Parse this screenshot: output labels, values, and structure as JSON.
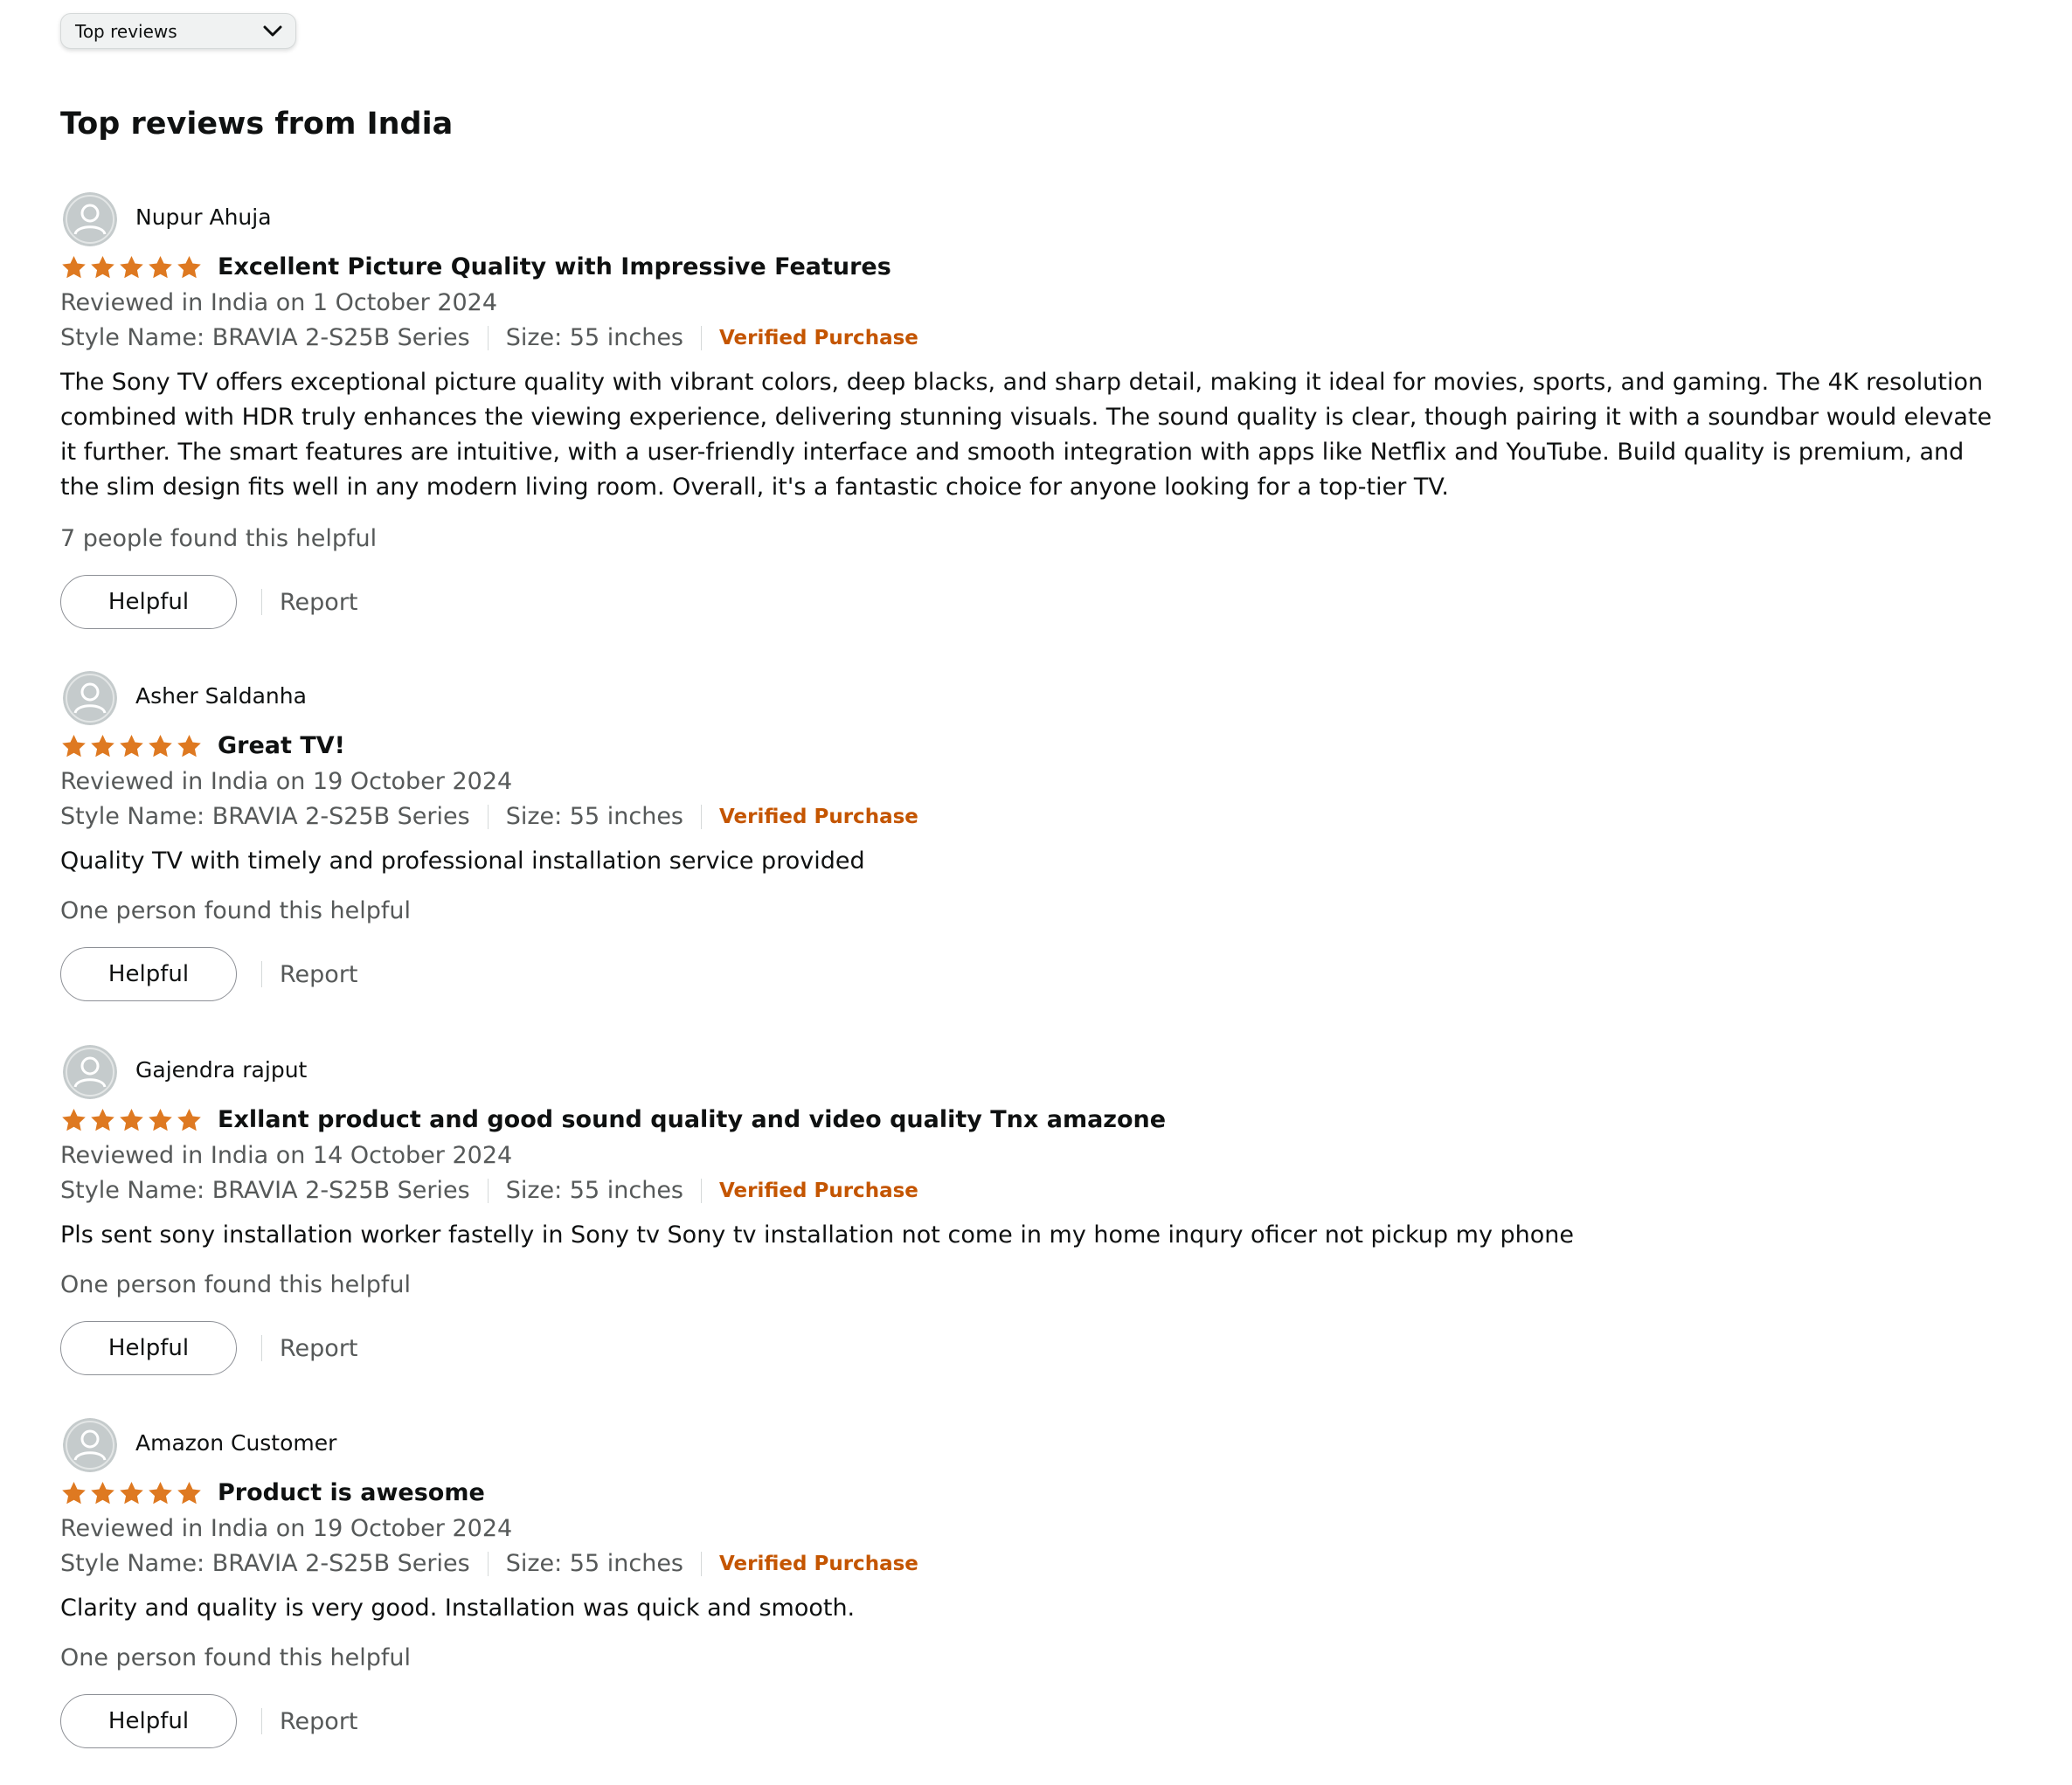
{
  "sort": {
    "selected": "Top reviews"
  },
  "heading": "Top reviews from India",
  "colors": {
    "star": "#de7921",
    "verified": "#c45500",
    "muted": "#565959",
    "text": "#0f1111"
  },
  "reviews": [
    {
      "author": "Nupur Ahuja",
      "rating": 5,
      "title": "Excellent Picture Quality with Impressive Features",
      "date": "Reviewed in India on 1 October 2024",
      "style": "Style Name: BRAVIA 2-S25B Series",
      "size": "Size: 55 inches",
      "verified": "Verified Purchase",
      "body": "The Sony TV offers exceptional picture quality with vibrant colors, deep blacks, and sharp detail, making it ideal for movies, sports, and gaming. The 4K resolution combined with HDR truly enhances the viewing experience, delivering stunning visuals. The sound quality is clear, though pairing it with a soundbar would elevate it further. The smart features are intuitive, with a user-friendly interface and smooth integration with apps like Netflix and YouTube. Build quality is premium, and the slim design fits well in any modern living room. Overall, it's a fantastic choice for anyone looking for a top-tier TV.",
      "helpful_count": "7 people found this helpful",
      "helpful_label": "Helpful",
      "report_label": "Report"
    },
    {
      "author": "Asher Saldanha",
      "rating": 5,
      "title": "Great TV!",
      "date": "Reviewed in India on 19 October 2024",
      "style": "Style Name: BRAVIA 2-S25B Series",
      "size": "Size: 55 inches",
      "verified": "Verified Purchase",
      "body": "Quality TV with timely and professional installation service provided",
      "helpful_count": "One person found this helpful",
      "helpful_label": "Helpful",
      "report_label": "Report"
    },
    {
      "author": "Gajendra rajput",
      "rating": 5,
      "title": "Exllant product and good sound quality and video quality Tnx amazone",
      "date": "Reviewed in India on 14 October 2024",
      "style": "Style Name: BRAVIA 2-S25B Series",
      "size": "Size: 55 inches",
      "verified": "Verified Purchase",
      "body": "Pls sent sony installation worker fastelly in Sony tv Sony tv installation not come in my home inqury oficer not pickup my phone",
      "helpful_count": "One person found this helpful",
      "helpful_label": "Helpful",
      "report_label": "Report"
    },
    {
      "author": "Amazon Customer",
      "rating": 5,
      "title": "Product is awesome",
      "date": "Reviewed in India on 19 October 2024",
      "style": "Style Name: BRAVIA 2-S25B Series",
      "size": "Size: 55 inches",
      "verified": "Verified Purchase",
      "body": "Clarity and quality is very good. Installation was quick and smooth.",
      "helpful_count": "One person found this helpful",
      "helpful_label": "Helpful",
      "report_label": "Report"
    }
  ]
}
